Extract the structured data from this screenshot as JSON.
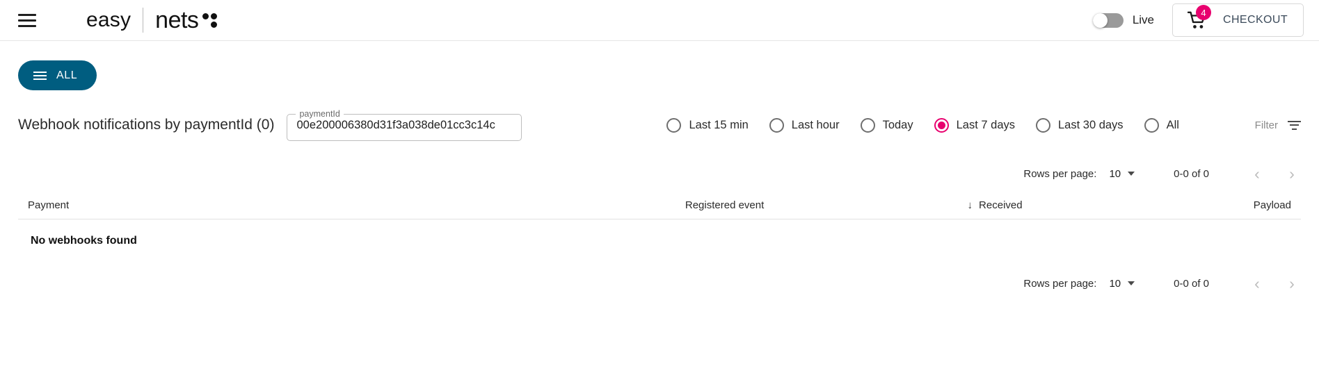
{
  "header": {
    "menu_icon": "hamburger-icon",
    "brand_easy": "easy",
    "brand_nets": "nets",
    "live_toggle_label": "Live",
    "live_toggle_state": "off",
    "cart_icon": "shopping-cart-icon",
    "cart_badge_count": "4",
    "checkout_label": "CHECKOUT"
  },
  "toolbar": {
    "all_button_label": "ALL",
    "all_button_icon": "list-icon",
    "all_button_color": "#005d80"
  },
  "page": {
    "title": "Webhook notifications by paymentId (0)"
  },
  "search": {
    "field_label": "paymentId",
    "value": "00e200006380d31f3a038de01cc3c14c",
    "placeholder": "paymentId"
  },
  "time_filter": {
    "selected": "Last 7 days",
    "accent_color": "#e8006e",
    "options": [
      {
        "label": "Last 15 min",
        "selected": false
      },
      {
        "label": "Last hour",
        "selected": false
      },
      {
        "label": "Today",
        "selected": false
      },
      {
        "label": "Last 7 days",
        "selected": true
      },
      {
        "label": "Last 30 days",
        "selected": false
      },
      {
        "label": "All",
        "selected": false
      }
    ]
  },
  "filter": {
    "label": "Filter",
    "icon": "filter-icon"
  },
  "pagination": {
    "rows_per_page_label": "Rows per page:",
    "rows_per_page_value": "10",
    "range": "0-0 of 0",
    "prev_icon": "chevron-left-icon",
    "next_icon": "chevron-right-icon",
    "prev_glyph": "‹",
    "next_glyph": "›"
  },
  "table": {
    "columns": [
      {
        "label": "Payment",
        "align": "left"
      },
      {
        "label": "Registered event",
        "align": "left"
      },
      {
        "label": "Received",
        "align": "left",
        "sorted": "desc",
        "sort_glyph": "↓"
      },
      {
        "label": "Payload",
        "align": "right"
      }
    ],
    "rows": [],
    "empty_message": "No webhooks found"
  }
}
